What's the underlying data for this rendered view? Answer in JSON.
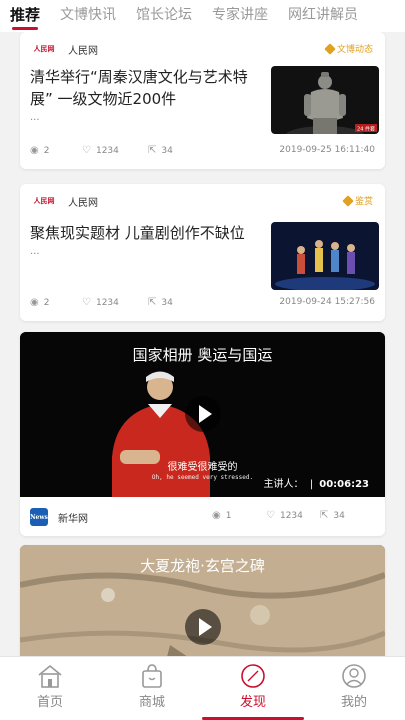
{
  "tabs": [
    "推荐",
    "文博快讯",
    "馆长论坛",
    "专家讲座",
    "网红讲解员"
  ],
  "articles": [
    {
      "source": "人民网",
      "source_logo": "人民网",
      "tag": "文博动态",
      "title": "清华举行“周秦汉唐文化与艺术特展” 一级文物近200件",
      "ellipsis": "...",
      "comments": "2",
      "likes": "1234",
      "shares": "34",
      "date": "2019-09-25 16:11:40",
      "thumb_badge": "24 件套",
      "thumb": "terracotta-warrior-thumbnail"
    },
    {
      "source": "人民网",
      "source_logo": "人民网",
      "tag": "鉴赏",
      "title": "聚焦现实题材 儿童剧创作不缺位",
      "ellipsis": "...",
      "comments": "2",
      "likes": "1234",
      "shares": "34",
      "date": "2019-09-24 15:27:56",
      "thumb": "children-play-stage-thumbnail"
    }
  ],
  "videos": [
    {
      "title": "国家相册 奥运与国运",
      "subtitle_cn": "很难受很难受的",
      "subtitle_en": "Oh, he seemed very stressed.",
      "speaker_label": "主讲人：",
      "duration": "00:06:23",
      "source": "新华网",
      "source_logo": "News",
      "comments": "1",
      "likes": "1234",
      "shares": "34"
    },
    {
      "title": "大夏龙袍·玄宫之碑"
    }
  ],
  "nav": [
    {
      "label": "首页",
      "icon": "home-icon"
    },
    {
      "label": "商城",
      "icon": "shopping-bag-icon"
    },
    {
      "label": "发现",
      "icon": "compass-icon",
      "active": true
    },
    {
      "label": "我的",
      "icon": "profile-icon"
    }
  ],
  "colors": {
    "accent": "#c8102e",
    "tag": "#e0a020",
    "background": "#f2f2f2"
  }
}
